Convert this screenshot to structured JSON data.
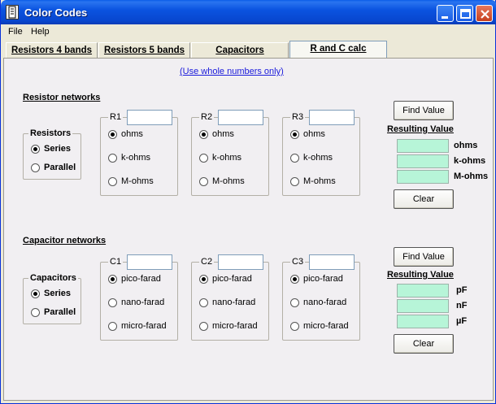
{
  "window": {
    "title": "Color Codes"
  },
  "menu": [
    "File",
    "Help"
  ],
  "tabs": [
    {
      "label": "Resistors 4 bands"
    },
    {
      "label": "Resistors 5 bands"
    },
    {
      "label": "Capacitors"
    },
    {
      "label": "R and C calc"
    }
  ],
  "note": "(Use whole numbers only)",
  "resistor": {
    "section_title": "Resistor networks",
    "mode_group": {
      "title": "Resistors",
      "options": [
        "Series",
        "Parallel"
      ],
      "selected": "Series"
    },
    "inputs": [
      {
        "label": "R1",
        "value": "",
        "units": [
          "ohms",
          "k-ohms",
          "M-ohms"
        ],
        "selected": "ohms"
      },
      {
        "label": "R2",
        "value": "",
        "units": [
          "ohms",
          "k-ohms",
          "M-ohms"
        ],
        "selected": "ohms"
      },
      {
        "label": "R3",
        "value": "",
        "units": [
          "ohms",
          "k-ohms",
          "M-ohms"
        ],
        "selected": "ohms"
      }
    ],
    "find_label": "Find Value",
    "result_title": "Resulting Value",
    "result_units": [
      "ohms",
      "k-ohms",
      "M-ohms"
    ],
    "result_values": [
      "",
      "",
      ""
    ],
    "clear_label": "Clear"
  },
  "capacitor": {
    "section_title": "Capacitor networks",
    "mode_group": {
      "title": "Capacitors",
      "options": [
        "Series",
        "Parallel"
      ],
      "selected": "Series"
    },
    "inputs": [
      {
        "label": "C1",
        "value": "",
        "units": [
          "pico-farad",
          "nano-farad",
          "micro-farad"
        ],
        "selected": "pico-farad"
      },
      {
        "label": "C2",
        "value": "",
        "units": [
          "pico-farad",
          "nano-farad",
          "micro-farad"
        ],
        "selected": "pico-farad"
      },
      {
        "label": "C3",
        "value": "",
        "units": [
          "pico-farad",
          "nano-farad",
          "micro-farad"
        ],
        "selected": "pico-farad"
      }
    ],
    "find_label": "Find Value",
    "result_title": "Resulting Value",
    "result_units": [
      "pF",
      "nF",
      "µF"
    ],
    "result_values": [
      "",
      "",
      ""
    ],
    "clear_label": "Clear"
  },
  "colors": {
    "title_bar": "#0b54e0",
    "result_box": "#b7f5d8",
    "link": "#1a1adb"
  },
  "icons": {
    "app": "document-icon",
    "minimize": "minimize-icon",
    "maximize": "maximize-icon",
    "close": "close-icon"
  }
}
